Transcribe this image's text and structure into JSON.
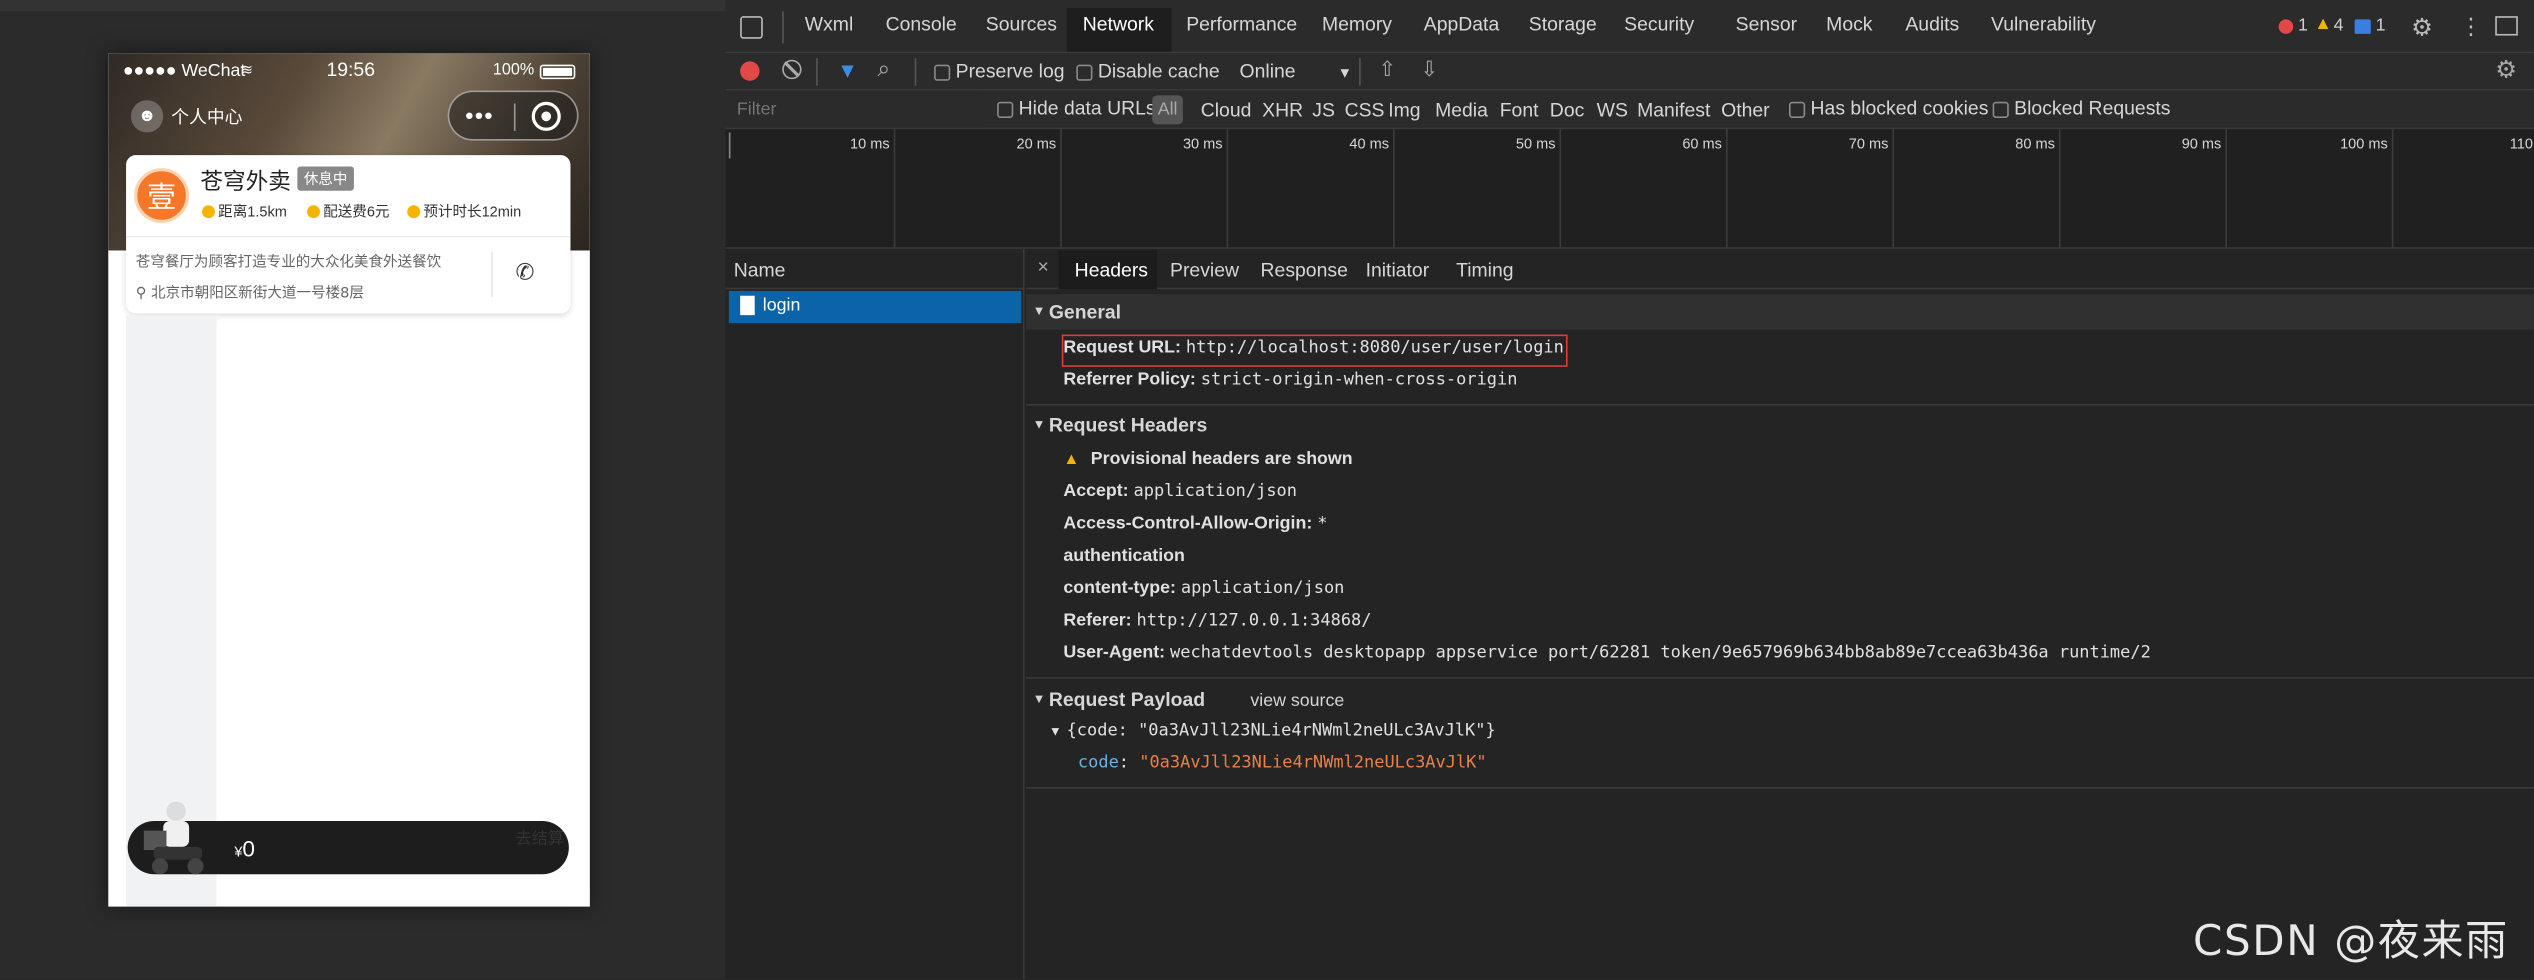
{
  "simulator": {
    "status": {
      "carrier": "●●●●● WeChat",
      "wifi": "wifi",
      "time": "19:56",
      "battery": "100%"
    },
    "user_center": "个人中心",
    "shop": {
      "name": "苍穹外卖",
      "status": "休息中",
      "distance": "距离1.5km",
      "delivery_fee": "配送费6元",
      "eta": "预计时长12min",
      "description": "苍穹餐厅为顾客打造专业的大众化美食外送餐饮",
      "address": "北京市朝阳区新街大道一号楼8层"
    },
    "cart": {
      "price": "0",
      "currency": "¥",
      "settle": "去结算"
    }
  },
  "devtools": {
    "tabs": [
      "Wxml",
      "Console",
      "Sources",
      "Network",
      "Performance",
      "Memory",
      "AppData",
      "Storage",
      "Security",
      "Sensor",
      "Mock",
      "Audits",
      "Vulnerability"
    ],
    "active_tab": "Network",
    "counts": {
      "errors": "1",
      "warnings": "4",
      "info": "1"
    },
    "toolbar": {
      "preserve_log": "Preserve log",
      "disable_cache": "Disable cache",
      "throttle": "Online"
    },
    "filter": {
      "placeholder": "Filter",
      "hide_data_urls": "Hide data URLs",
      "types": [
        "All",
        "Cloud",
        "XHR",
        "JS",
        "CSS",
        "Img",
        "Media",
        "Font",
        "Doc",
        "WS",
        "Manifest",
        "Other"
      ],
      "has_blocked_cookies": "Has blocked cookies",
      "blocked_requests": "Blocked Requests"
    },
    "timeline_ticks": [
      "10 ms",
      "20 ms",
      "30 ms",
      "40 ms",
      "50 ms",
      "60 ms",
      "70 ms",
      "80 ms",
      "90 ms",
      "100 ms",
      "110"
    ],
    "name_header": "Name",
    "requests": [
      "login"
    ],
    "detail_tabs": [
      "Headers",
      "Preview",
      "Response",
      "Initiator",
      "Timing"
    ],
    "general": {
      "title": "General",
      "request_url_label": "Request URL:",
      "request_url": "http://localhost:8080/user/user/login",
      "referrer_policy_label": "Referrer Policy:",
      "referrer_policy": "strict-origin-when-cross-origin"
    },
    "request_headers": {
      "title": "Request Headers",
      "warning": "Provisional headers are shown",
      "rows": [
        {
          "k": "Accept:",
          "v": "application/json"
        },
        {
          "k": "Access-Control-Allow-Origin:",
          "v": "*"
        },
        {
          "k": "authentication",
          "v": ""
        },
        {
          "k": "content-type:",
          "v": "application/json"
        },
        {
          "k": "Referer:",
          "v": "http://127.0.0.1:34868/"
        },
        {
          "k": "User-Agent:",
          "v": "wechatdevtools desktopapp appservice port/62281 token/9e657969b634bb8ab89e7ccea63b436a runtime/2"
        }
      ]
    },
    "payload": {
      "title": "Request Payload",
      "view_source": "view source",
      "summary": "{code: \"0a3AvJll23NLie4rNWml2neULc3AvJlK\"}",
      "key": "code",
      "value": "\"0a3AvJll23NLie4rNWml2neULc3AvJlK\""
    }
  },
  "watermark": "CSDN @夜来雨"
}
